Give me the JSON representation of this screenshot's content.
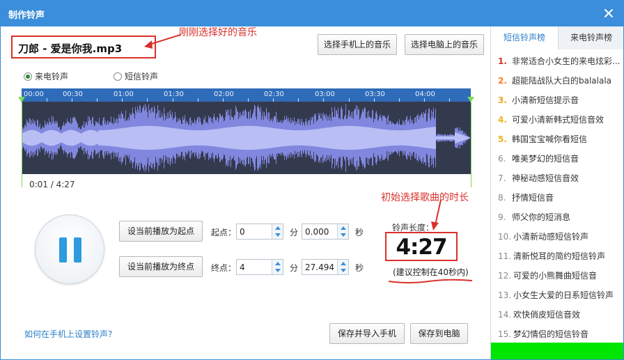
{
  "window": {
    "title": "制作铃声"
  },
  "file": {
    "name": "刀郎 - 爱是你我.mp3"
  },
  "annotations": {
    "selected_music": "刚刚选择好的音乐",
    "initial_duration": "初始选择歌曲的时长"
  },
  "buttons": {
    "phone_music": "选择手机上的音乐",
    "pc_music": "选择电脑上的音乐",
    "set_start": "设当前播放为起点",
    "set_end": "设当前播放为终点",
    "save_import": "保存并导入手机",
    "save_pc": "保存到电脑"
  },
  "mode": {
    "call_label": "来电铃声",
    "sms_label": "短信铃声",
    "selected": "call"
  },
  "waveform": {
    "ticks": [
      "00:00",
      "00:30",
      "01:00",
      "01:30",
      "02:00",
      "02:30",
      "03:00",
      "03:30",
      "04:00"
    ]
  },
  "playback": {
    "position": "0:01 / 4:27"
  },
  "start": {
    "label": "起点：",
    "min": "0",
    "min_unit": "分",
    "sec": "0.000",
    "sec_unit": "秒"
  },
  "end": {
    "label": "终点：",
    "min": "4",
    "min_unit": "分",
    "sec": "27.494",
    "sec_unit": "秒"
  },
  "ringtone": {
    "length_label": "铃声长度：",
    "length": "4:27",
    "hint": "(建议控制在40秒内)"
  },
  "help": {
    "link": "如何在手机上设置铃声?"
  },
  "sidebar": {
    "tabs": [
      "短信铃声榜",
      "来电铃声榜"
    ],
    "active_tab": 0,
    "items": [
      {
        "num": "1.",
        "title": "非常适合小女生的来电炫彩..."
      },
      {
        "num": "2.",
        "title": "超能陆战队大白的balalala"
      },
      {
        "num": "3.",
        "title": "小清新短信提示音"
      },
      {
        "num": "4.",
        "title": "可爱小清新韩式短信音效"
      },
      {
        "num": "5.",
        "title": "韩国宝宝喊你看短信"
      },
      {
        "num": "6.",
        "title": "唯美梦幻的短信音"
      },
      {
        "num": "7.",
        "title": "神秘动感短信音效"
      },
      {
        "num": "8.",
        "title": "抒情短信音"
      },
      {
        "num": "9.",
        "title": "师父你的短消息"
      },
      {
        "num": "10.",
        "title": "小清新动感短信铃声"
      },
      {
        "num": "11.",
        "title": "清新悦耳的简约短信铃声"
      },
      {
        "num": "12.",
        "title": "可爱的小熊舞曲短信音"
      },
      {
        "num": "13.",
        "title": "小女生大爱的日系短信铃声"
      },
      {
        "num": "14.",
        "title": "欢快俏皮短信音效"
      },
      {
        "num": "15.",
        "title": "梦幻情侣的短信铃音"
      }
    ]
  },
  "colors": {
    "accent": "#3b8edb",
    "annotation": "#d9302b",
    "waveform": "#8a8ff0"
  }
}
